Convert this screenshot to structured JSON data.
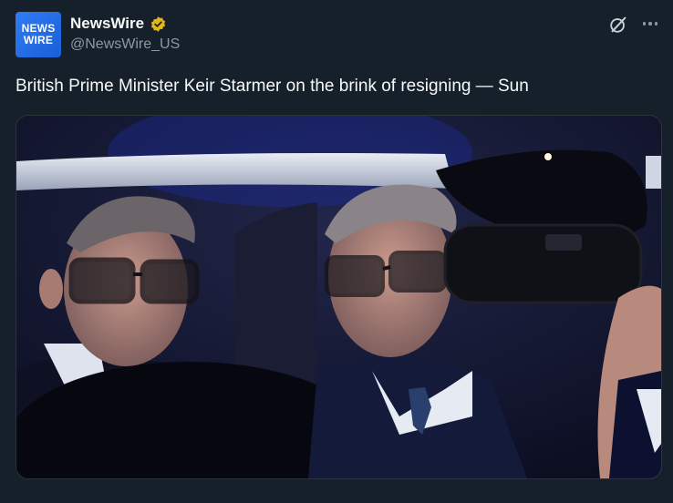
{
  "author": {
    "avatar_line1": "NEWS",
    "avatar_line2": "WIRE",
    "display_name": "NewsWire",
    "handle": "@NewsWire_US",
    "verified": true
  },
  "tweet": {
    "text": "British Prime Minister Keir Starmer on the brink of resigning — Sun"
  },
  "media": {
    "alt": "Keir Starmer seated in the back of a car at night with another man"
  },
  "icons": {
    "grok": "grok-icon",
    "more": "more-icon",
    "verified": "verified-badge-icon"
  },
  "colors": {
    "background": "#15202b",
    "text": "#f7f9f9",
    "secondary_text": "#8b98a5",
    "verified_gold": "#e2b719",
    "avatar_blue": "#2f7cf6"
  }
}
